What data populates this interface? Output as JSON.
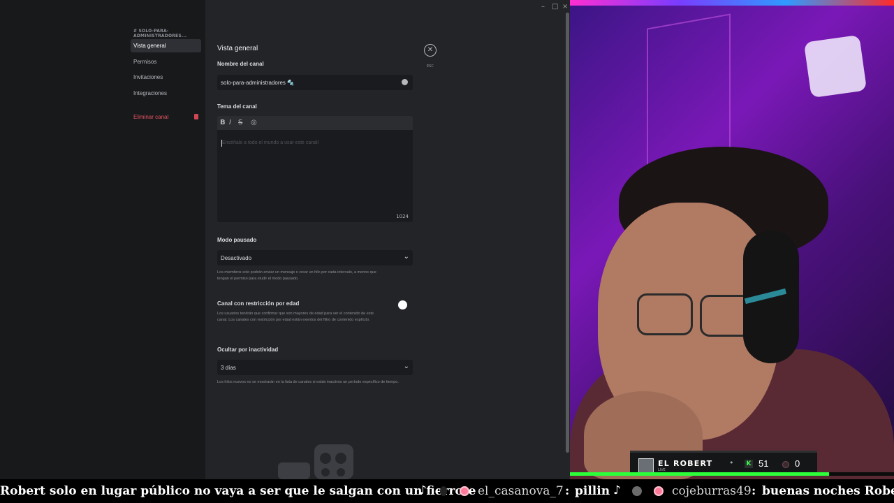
{
  "window_controls": {
    "minimize": "–",
    "maximize": "□",
    "close": "×"
  },
  "sidebar": {
    "category": "# SOLO-PARA-ADMINISTRADORES...",
    "items": [
      {
        "label": "Vista general",
        "active": true
      },
      {
        "label": "Permisos"
      },
      {
        "label": "Invitaciones"
      },
      {
        "label": "Integraciones"
      }
    ],
    "delete_label": "Eliminar canal"
  },
  "settings": {
    "title": "Vista general",
    "channel_name_label": "Nombre del canal",
    "channel_name_value": "solo-para-administradores 🔩",
    "topic_label": "Tema del canal",
    "toolbar": {
      "bold": "B",
      "italic": "I",
      "strike": "S",
      "spoiler": "◎"
    },
    "topic_placeholder": "Enséñale a todo el mundo a usar este canal!",
    "topic_counter": "1024",
    "slowmode_label": "Modo pausado",
    "slowmode_value": "Desactivado",
    "slowmode_help": "Los miembros solo podrán enviar un mensaje o crear un hilo por cada intervalo, a menos que tengan el permiso para eludir el modo pausado.",
    "age_label": "Canal con restricción por edad",
    "age_help": "Los usuarios tendrán que confirmar que son mayores de edad para ver el contenido de este canal. Los canales con restricción por edad están exentos del filtro de contenido explícito.",
    "inactivity_label": "Ocultar por inactividad",
    "inactivity_value": "3 días",
    "inactivity_help": "Los hilos nuevos no se mostrarán en la lista de canales si están inactivos un período específico de tiempo.",
    "esc_label": "ESC",
    "close_glyph": "✕"
  },
  "stream": {
    "streamer_name": "EL ROBERT",
    "live_tag": "LIVE",
    "separator": "•",
    "kick_badge": "K",
    "viewers": "51",
    "second_count": "0"
  },
  "ticker": {
    "message_1": "Robert solo en lugar público no vaya a ser que le salgan con un fierrote",
    "user_2": "el_casanova_7",
    "message_2": "pillin",
    "user_3": "cojeburras49",
    "message_3": "buenas noches Robert",
    "colon": ":",
    "note_glyph": "♪"
  },
  "colors": {
    "accent_live": "#2cff3a",
    "danger": "#e45360",
    "panel": "#232428"
  }
}
